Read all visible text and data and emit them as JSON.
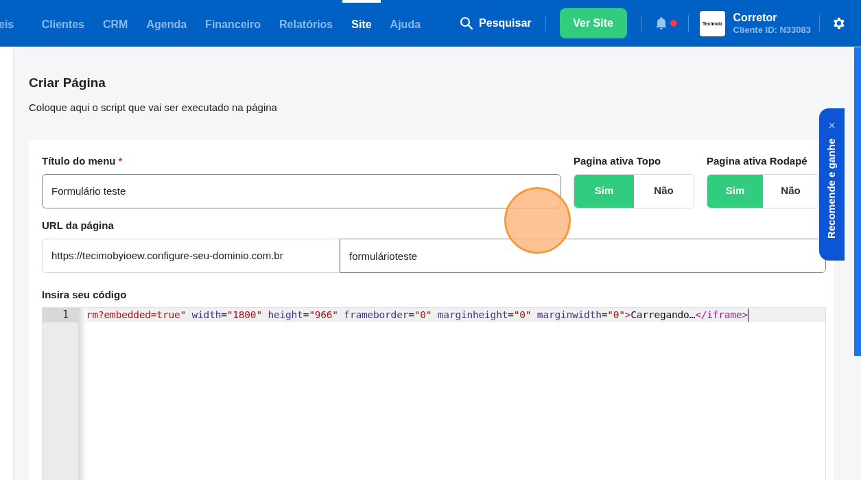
{
  "nav": {
    "items": [
      {
        "label": "eis",
        "selected": false
      },
      {
        "label": "Clientes",
        "selected": false
      },
      {
        "label": "CRM",
        "selected": false
      },
      {
        "label": "Agenda",
        "selected": false
      },
      {
        "label": "Financeiro",
        "selected": false
      },
      {
        "label": "Relatórios",
        "selected": false
      },
      {
        "label": "Site",
        "selected": true
      },
      {
        "label": "Ajuda",
        "selected": false
      }
    ],
    "search": "Pesquisar",
    "view_site": "Ver Site",
    "notification_unread": true,
    "logo_text": "Tecimob",
    "user": {
      "name": "Corretor",
      "client_id": "Cliente ID: N33083"
    }
  },
  "page": {
    "title": "Criar Página",
    "subtitle": "Coloque aqui o script que vai ser executado na página"
  },
  "form": {
    "menu_title": {
      "label": "Título do menu",
      "required_mark": "*",
      "value": "Formulário teste"
    },
    "toggles": [
      {
        "label": "Pagina ativa Topo",
        "options": [
          {
            "label": "Sim",
            "selected": true
          },
          {
            "label": "Não",
            "selected": false
          }
        ]
      },
      {
        "label": "Pagina ativa Rodapé",
        "options": [
          {
            "label": "Sim",
            "selected": true
          },
          {
            "label": "Não",
            "selected": false
          }
        ]
      }
    ],
    "url": {
      "label": "URL da página",
      "prefix": "https://tecimobyioew.configure-seu-dominio.com.br",
      "value": "formulárioteste"
    },
    "code": {
      "label": "Insira seu código",
      "line_number": "1",
      "tokens": [
        {
          "text": "rm?embedded=true\"",
          "kind": "string"
        },
        {
          "text": " width",
          "kind": "attr"
        },
        {
          "text": "=",
          "kind": "plain"
        },
        {
          "text": "\"1800\"",
          "kind": "string"
        },
        {
          "text": " height",
          "kind": "attr"
        },
        {
          "text": "=",
          "kind": "plain"
        },
        {
          "text": "\"966\"",
          "kind": "string"
        },
        {
          "text": " frameborder",
          "kind": "attr"
        },
        {
          "text": "=",
          "kind": "plain"
        },
        {
          "text": "\"0\"",
          "kind": "string"
        },
        {
          "text": " marginheight",
          "kind": "attr"
        },
        {
          "text": "=",
          "kind": "plain"
        },
        {
          "text": "\"0\"",
          "kind": "string"
        },
        {
          "text": " marginwidth",
          "kind": "attr"
        },
        {
          "text": "=",
          "kind": "plain"
        },
        {
          "text": "\"0\"",
          "kind": "string"
        },
        {
          "text": ">",
          "kind": "tag"
        },
        {
          "text": "Carregando…",
          "kind": "plain"
        },
        {
          "text": "</iframe>",
          "kind": "tag"
        }
      ]
    }
  },
  "referral_tab": {
    "label": "Recomende e ganhe",
    "close": "×"
  }
}
